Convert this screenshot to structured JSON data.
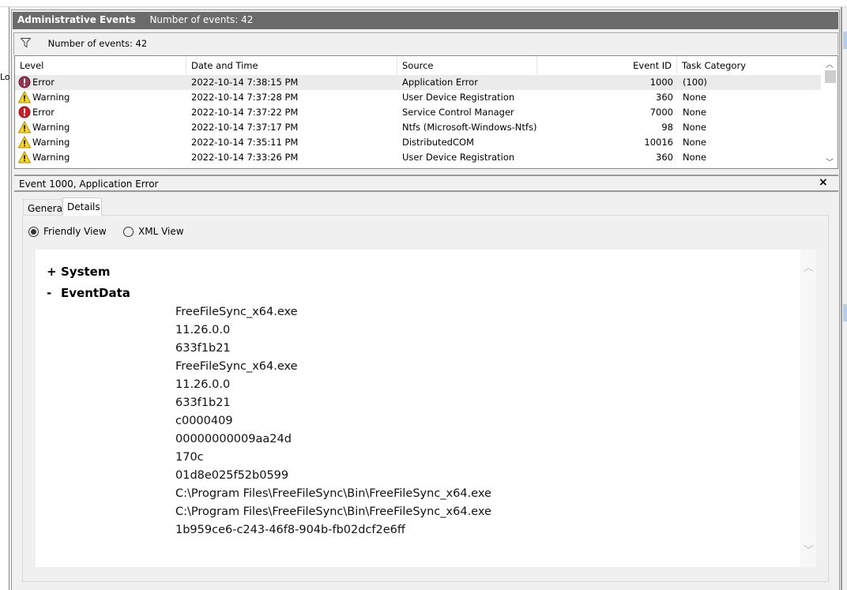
{
  "left_panel": {
    "partial_text": "Lo"
  },
  "header": {
    "title": "Administrative Events",
    "count": "Number of events: 42"
  },
  "filter_bar": {
    "icon": "filter-icon",
    "text": "Number of events: 42"
  },
  "table": {
    "columns": [
      "Level",
      "Date and Time",
      "Source",
      "Event ID",
      "Task Category"
    ],
    "rows": [
      {
        "level": "Error",
        "icon": "error-icon",
        "datetime": "2022-10-14 7:38:15 PM",
        "source": "Application Error",
        "event_id": "1000",
        "task": "(100)",
        "selected": true
      },
      {
        "level": "Warning",
        "icon": "warning-icon",
        "datetime": "2022-10-14 7:37:28 PM",
        "source": "User Device Registration",
        "event_id": "360",
        "task": "None"
      },
      {
        "level": "Error",
        "icon": "error-icon",
        "datetime": "2022-10-14 7:37:22 PM",
        "source": "Service Control Manager",
        "event_id": "7000",
        "task": "None"
      },
      {
        "level": "Warning",
        "icon": "warning-icon",
        "datetime": "2022-10-14 7:37:17 PM",
        "source": "Ntfs (Microsoft-Windows-Ntfs)",
        "event_id": "98",
        "task": "None"
      },
      {
        "level": "Warning",
        "icon": "warning-icon",
        "datetime": "2022-10-14 7:35:11 PM",
        "source": "DistributedCOM",
        "event_id": "10016",
        "task": "None"
      },
      {
        "level": "Warning",
        "icon": "warning-icon",
        "datetime": "2022-10-14 7:33:26 PM",
        "source": "User Device Registration",
        "event_id": "360",
        "task": "None"
      }
    ]
  },
  "detail": {
    "title": "Event 1000, Application Error",
    "close": "×",
    "tabs": [
      "General",
      "Details"
    ],
    "active_tab": "Details",
    "views": [
      "Friendly View",
      "XML View"
    ],
    "selected_view": "Friendly View",
    "system": {
      "toggle": "+",
      "label": "System"
    },
    "eventdata": {
      "toggle": "-",
      "label": "EventData"
    },
    "values": [
      "FreeFileSync_x64.exe",
      "11.26.0.0",
      "633f1b21",
      "FreeFileSync_x64.exe",
      "11.26.0.0",
      "633f1b21",
      "c0000409",
      "00000000009aa24d",
      "170c",
      "01d8e025f52b0599",
      "C:\\Program Files\\FreeFileSync\\Bin\\FreeFileSync_x64.exe",
      "C:\\Program Files\\FreeFileSync\\Bin\\FreeFileSync_x64.exe",
      "1b959ce6-c243-46f8-904b-fb02dcf2e6ff"
    ]
  }
}
